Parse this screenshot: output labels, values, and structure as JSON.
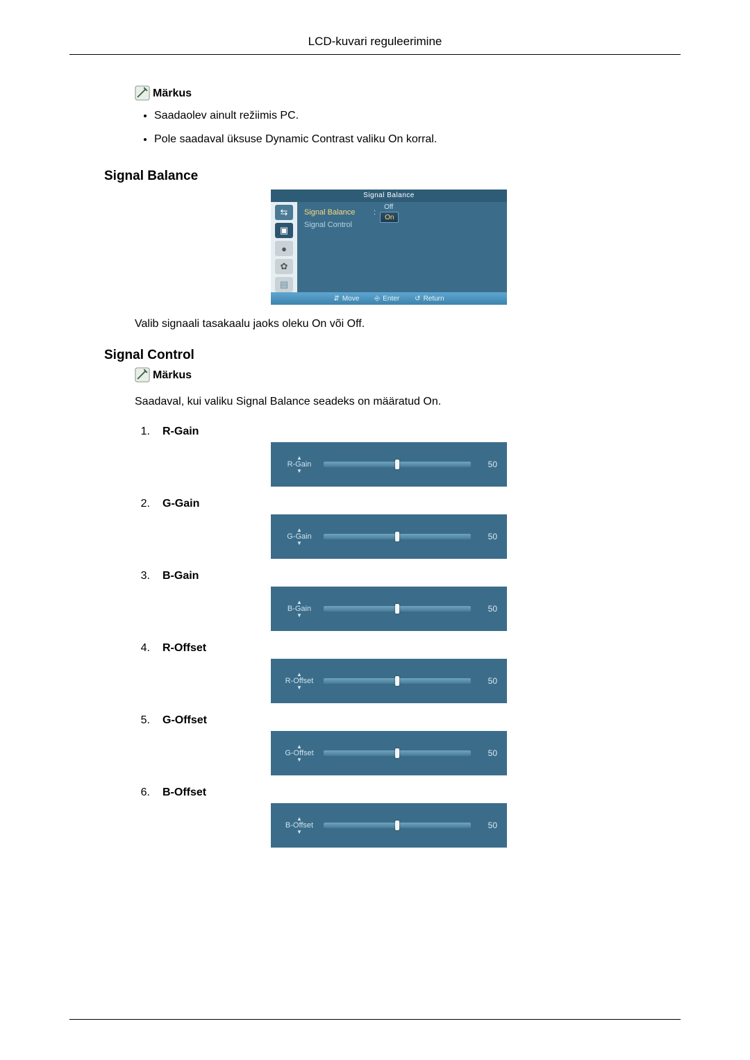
{
  "header_title": "LCD-kuvari reguleerimine",
  "note_label": "Märkus",
  "bullets": [
    "Saadaolev ainult režiimis PC.",
    "Pole saadaval üksuse Dynamic Contrast valiku On korral."
  ],
  "section_signal_balance": "Signal Balance",
  "section_signal_control": "Signal Control",
  "balance_description": "Valib signaali tasakaalu jaoks oleku On või Off.",
  "control_note_text": "Saadaval, kui valiku Signal Balance seadeks on määratud On.",
  "osd": {
    "title": "Signal Balance",
    "row1_label": "Signal Balance",
    "row2_label": "Signal Control",
    "opt_off": "Off",
    "opt_on": "On",
    "footer_move": "Move",
    "footer_enter": "Enter",
    "footer_return": "Return"
  },
  "controls": [
    {
      "num": "1.",
      "name": "R-Gain",
      "slider_label": "R-Gain",
      "value": "50"
    },
    {
      "num": "2.",
      "name": "G-Gain",
      "slider_label": "G-Gain",
      "value": "50"
    },
    {
      "num": "3.",
      "name": "B-Gain",
      "slider_label": "B-Gain",
      "value": "50"
    },
    {
      "num": "4.",
      "name": "R-Offset",
      "slider_label": "R-Offset",
      "value": "50"
    },
    {
      "num": "5.",
      "name": "G-Offset",
      "slider_label": "G-Offset",
      "value": "50"
    },
    {
      "num": "6.",
      "name": "B-Offset",
      "slider_label": "B-Offset",
      "value": "50"
    }
  ]
}
